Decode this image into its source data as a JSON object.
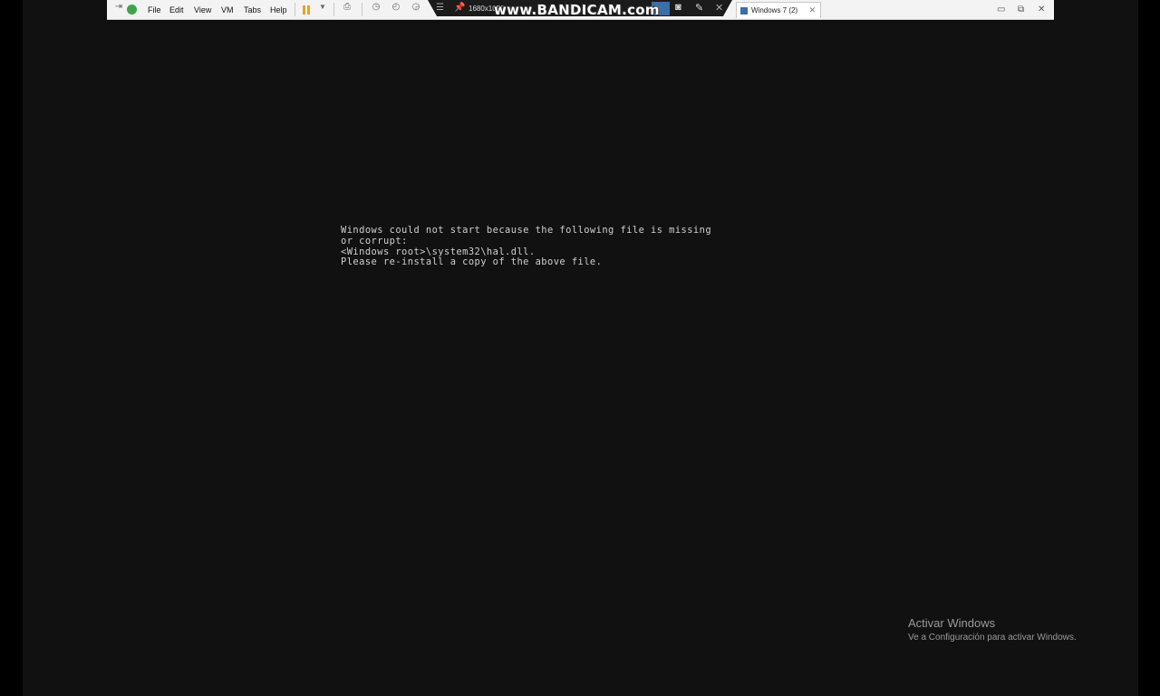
{
  "toolbar": {
    "menu": [
      "File",
      "Edit",
      "View",
      "VM",
      "Tabs",
      "Help"
    ],
    "resolution": "1680x1050",
    "tab_title": "Windows 7 (2)",
    "icons": [
      "pin-back-icon",
      "power-on-icon",
      "pause-icon",
      "dropdown-arrow-icon",
      "send-keys-icon",
      "snapshot-icon",
      "snapshot-revert-icon",
      "snapshot-manager-icon",
      "menu-icon",
      "pin-icon",
      "monitor-icon",
      "camera-icon",
      "pencil-icon",
      "close-icon",
      "minimize-icon",
      "restore-icon",
      "window-close-icon"
    ]
  },
  "watermark": "www.BANDICAM.com",
  "boot_error": {
    "lines": [
      "Windows could not start because the following file is missing",
      "or corrupt:",
      "<Windows root>\\system32\\hal.dll.",
      "Please re-install a copy of the above file."
    ]
  },
  "activation": {
    "title": "Activar Windows",
    "subtitle": "Ve a Configuración para activar Windows."
  },
  "colors": {
    "vm_background": "#111112",
    "boot_text": "#cfcfcf",
    "toolbar_bg": "#f3f3f3"
  }
}
